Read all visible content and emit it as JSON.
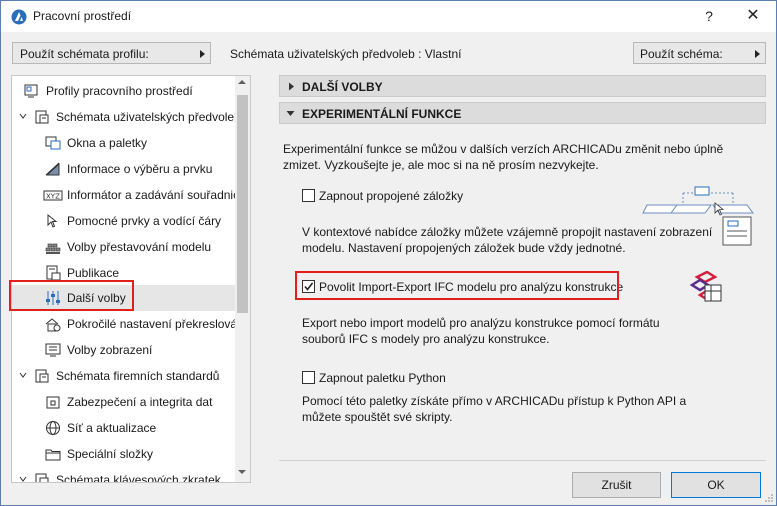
{
  "window": {
    "title": "Pracovní prostředí",
    "help": "?",
    "close": "✕"
  },
  "topbar": {
    "profile_button": "Použít schémata profilu:",
    "schemes_label": "Schémata uživatelských předvoleb :  Vlastní",
    "apply_scheme_button": "Použít schéma:"
  },
  "tree": {
    "items": [
      {
        "label": "Profily pracovního prostředí",
        "icon": "profiles-icon"
      },
      {
        "label": "Schémata uživatelských předvoleb",
        "icon": "user-scheme-icon"
      },
      {
        "label": "Okna a paletky",
        "icon": "windows-palettes-icon"
      },
      {
        "label": "Informace o výběru a prvku",
        "icon": "selection-info-icon"
      },
      {
        "label": "Informátor a zadávání souřadnic",
        "icon": "xyz-coordinates-icon"
      },
      {
        "label": "Pomocné prvky a vodící čáry",
        "icon": "guide-lines-icon"
      },
      {
        "label": "Volby přestavování modelu",
        "icon": "model-rebuild-icon"
      },
      {
        "label": "Publikace",
        "icon": "publishing-icon"
      },
      {
        "label": "Další volby",
        "icon": "more-options-icon",
        "selected": true
      },
      {
        "label": "Pokročilé nastavení překreslování",
        "icon": "redraw-settings-icon"
      },
      {
        "label": "Volby zobrazení",
        "icon": "display-options-icon"
      },
      {
        "label": "Schémata firemních standardů",
        "icon": "company-scheme-icon"
      },
      {
        "label": "Zabezpečení a integrita dat",
        "icon": "security-icon"
      },
      {
        "label": "Síť a aktualizace",
        "icon": "network-icon"
      },
      {
        "label": "Speciální složky",
        "icon": "folders-icon"
      },
      {
        "label": "Schémata klávesových zkratek",
        "icon": "shortcut-scheme-icon"
      }
    ]
  },
  "content": {
    "section_more": "DALŠÍ VOLBY",
    "section_experimental": "EXPERIMENTÁLNÍ FUNKCE",
    "intro": "Experimentální funkce se můžou v dalších verzích ARCHICADu změnit nebo úplně zmizet. Vyzkoušejte je, ale moc si na ně prosím nezvykejte.",
    "features": [
      {
        "label": "Zapnout propojené záložky",
        "checked": false,
        "description": "V kontextové nabídce záložky můžete vzájemně propojit nastavení zobrazení modelu. Nastavení propojených záložek bude vždy jednotné."
      },
      {
        "label": "Povolit Import-Export IFC modelu pro analýzu konstrukce",
        "checked": true,
        "description": "Export nebo import modelů pro analýzu konstrukce pomocí formátu souborů IFC s modely pro analýzu konstrukce."
      },
      {
        "label": "Zapnout paletku Python",
        "checked": false,
        "description": "Pomocí této paletky získáte přímo v ARCHICADu přístup k Python API a můžete spouštět své skripty."
      }
    ]
  },
  "footer": {
    "cancel": "Zrušit",
    "ok": "OK"
  },
  "colors": {
    "highlight_red": "#e0201b",
    "accent_blue": "#2a6ebb"
  }
}
